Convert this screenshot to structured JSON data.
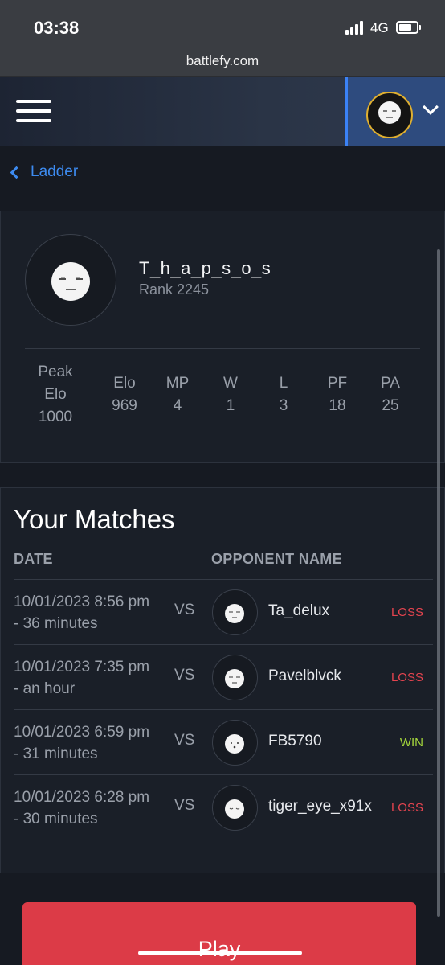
{
  "status_bar": {
    "time": "03:38",
    "network": "4G"
  },
  "browser": {
    "url": "battlefy.com"
  },
  "nav": {
    "back_label": "Ladder"
  },
  "profile": {
    "name": "T_h_a_p_s_o_s",
    "rank": "Rank 2245",
    "stats": [
      {
        "label": "Peak Elo",
        "value": "1000"
      },
      {
        "label": "Elo",
        "value": "969"
      },
      {
        "label": "MP",
        "value": "4"
      },
      {
        "label": "W",
        "value": "1"
      },
      {
        "label": "L",
        "value": "3"
      },
      {
        "label": "PF",
        "value": "18"
      },
      {
        "label": "PA",
        "value": "25"
      }
    ]
  },
  "matches": {
    "title": "Your Matches",
    "headers": {
      "date": "DATE",
      "opponent": "OPPONENT NAME"
    },
    "rows": [
      {
        "date": "10/01/2023 8:56 pm - 36 minutes",
        "vs": "VS",
        "opponent": "Ta_delux",
        "result": "LOSS",
        "result_color": "#e5444f"
      },
      {
        "date": "10/01/2023 7:35 pm - an hour",
        "vs": "VS",
        "opponent": "Pavelblvck",
        "result": "LOSS",
        "result_color": "#e5444f"
      },
      {
        "date": "10/01/2023 6:59 pm - 31 minutes",
        "vs": "VS",
        "opponent": "FB5790",
        "result": "WIN",
        "result_color": "#a4d63c"
      },
      {
        "date": "10/01/2023 6:28 pm - 30 minutes",
        "vs": "VS",
        "opponent": "tiger_eye_x91x",
        "result": "LOSS",
        "result_color": "#e5444f"
      }
    ]
  },
  "actions": {
    "play_label": "Play"
  },
  "colors": {
    "accent": "#3d8bf0",
    "play": "#dc3b47",
    "loss": "#e5444f",
    "win": "#a4d63c"
  }
}
